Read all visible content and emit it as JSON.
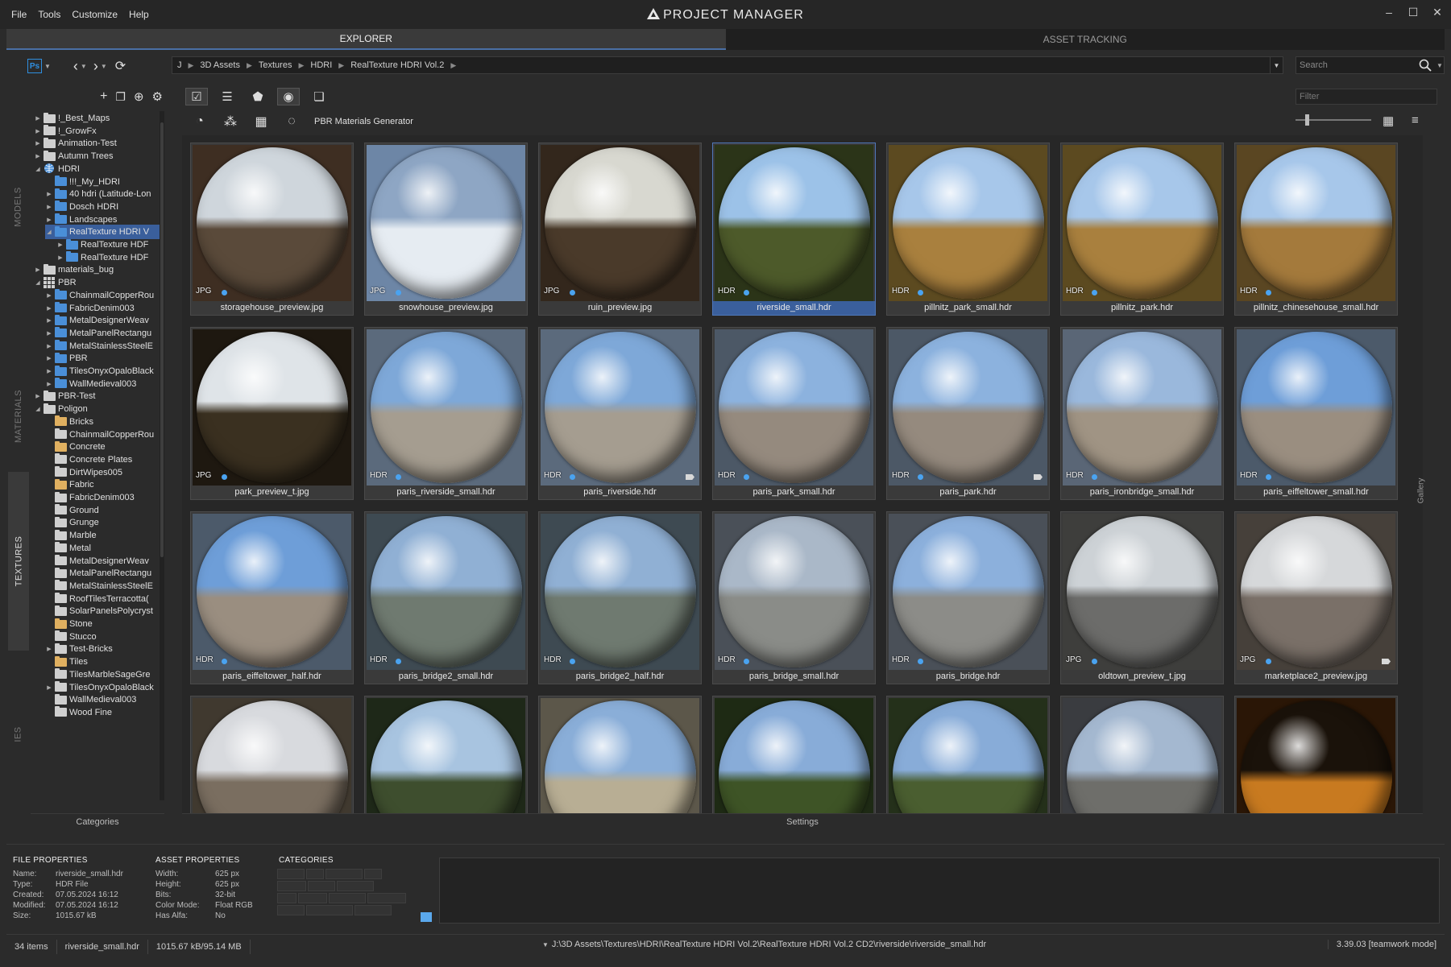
{
  "menu": [
    "File",
    "Tools",
    "Customize",
    "Help"
  ],
  "app_title": "PROJECT MANAGER",
  "window_controls": {
    "minimize": "–",
    "maximize": "☐",
    "close": "✕"
  },
  "main_tabs": [
    {
      "label": "EXPLORER",
      "active": true
    },
    {
      "label": "ASSET TRACKING",
      "active": false
    }
  ],
  "nav": {
    "app_icon": "Ps",
    "breadcrumb": [
      "J",
      "3D Assets",
      "Textures",
      "HDRI",
      "RealTexture HDRI Vol.2"
    ],
    "search_placeholder": "Search",
    "filter_placeholder": "Filter"
  },
  "side_tabs": [
    "MODELS",
    "MATERIALS",
    "TEXTURES",
    "IES"
  ],
  "side_tab_active": "TEXTURES",
  "tree": [
    {
      "label": "!_Best_Maps",
      "indent": 0,
      "arrow": "▶",
      "color": "#cfcfcf"
    },
    {
      "label": "!_GrowFx",
      "indent": 0,
      "arrow": "▶",
      "color": "#cfcfcf"
    },
    {
      "label": "Animation-Test",
      "indent": 0,
      "arrow": "▶",
      "color": "#cfcfcf"
    },
    {
      "label": "Autumn Trees",
      "indent": 0,
      "arrow": "▶",
      "color": "#cfcfcf"
    },
    {
      "label": "HDRI",
      "indent": 0,
      "arrow": "◢",
      "color": "#4a8fd8",
      "special": "globe"
    },
    {
      "label": "!!!_My_HDRI",
      "indent": 1,
      "arrow": "",
      "color": "#4a8fd8"
    },
    {
      "label": "40 hdri (Latitude-Lon",
      "indent": 1,
      "arrow": "▶",
      "color": "#4a8fd8"
    },
    {
      "label": "Dosch HDRI",
      "indent": 1,
      "arrow": "▶",
      "color": "#4a8fd8"
    },
    {
      "label": "Landscapes",
      "indent": 1,
      "arrow": "▶",
      "color": "#4a8fd8"
    },
    {
      "label": "RealTexture HDRI V",
      "indent": 1,
      "arrow": "◢",
      "color": "#4a8fd8",
      "selected": true
    },
    {
      "label": "RealTexture HDF",
      "indent": 2,
      "arrow": "▶",
      "color": "#4a8fd8"
    },
    {
      "label": "RealTexture HDF",
      "indent": 2,
      "arrow": "▶",
      "color": "#4a8fd8"
    },
    {
      "label": "materials_bug",
      "indent": 0,
      "arrow": "▶",
      "color": "#cfcfcf"
    },
    {
      "label": "PBR",
      "indent": 0,
      "arrow": "◢",
      "color": "#4a8fd8",
      "special": "grid"
    },
    {
      "label": "ChainmailCopperRou",
      "indent": 1,
      "arrow": "▶",
      "color": "#4a8fd8"
    },
    {
      "label": "FabricDenim003",
      "indent": 1,
      "arrow": "▶",
      "color": "#4a8fd8"
    },
    {
      "label": "MetalDesignerWeav",
      "indent": 1,
      "arrow": "▶",
      "color": "#4a8fd8"
    },
    {
      "label": "MetalPanelRectangu",
      "indent": 1,
      "arrow": "▶",
      "color": "#4a8fd8"
    },
    {
      "label": "MetalStainlessSteelE",
      "indent": 1,
      "arrow": "▶",
      "color": "#4a8fd8"
    },
    {
      "label": "PBR",
      "indent": 1,
      "arrow": "▶",
      "color": "#4a8fd8"
    },
    {
      "label": "TilesOnyxOpaloBlack",
      "indent": 1,
      "arrow": "▶",
      "color": "#4a8fd8"
    },
    {
      "label": "WallMedieval003",
      "indent": 1,
      "arrow": "▶",
      "color": "#4a8fd8"
    },
    {
      "label": "PBR-Test",
      "indent": 0,
      "arrow": "▶",
      "color": "#cfcfcf"
    },
    {
      "label": "Poligon",
      "indent": 0,
      "arrow": "◢",
      "color": "#cfcfcf"
    },
    {
      "label": "Bricks",
      "indent": 1,
      "arrow": "",
      "color": "#e0b060"
    },
    {
      "label": "ChainmailCopperRou",
      "indent": 1,
      "arrow": "",
      "color": "#cfcfcf"
    },
    {
      "label": "Concrete",
      "indent": 1,
      "arrow": "",
      "color": "#e0b060"
    },
    {
      "label": "Concrete Plates",
      "indent": 1,
      "arrow": "",
      "color": "#cfcfcf"
    },
    {
      "label": "DirtWipes005",
      "indent": 1,
      "arrow": "",
      "color": "#cfcfcf"
    },
    {
      "label": "Fabric",
      "indent": 1,
      "arrow": "",
      "color": "#e0b060"
    },
    {
      "label": "FabricDenim003",
      "indent": 1,
      "arrow": "",
      "color": "#cfcfcf"
    },
    {
      "label": "Ground",
      "indent": 1,
      "arrow": "",
      "color": "#cfcfcf"
    },
    {
      "label": "Grunge",
      "indent": 1,
      "arrow": "",
      "color": "#cfcfcf"
    },
    {
      "label": "Marble",
      "indent": 1,
      "arrow": "",
      "color": "#cfcfcf"
    },
    {
      "label": "Metal",
      "indent": 1,
      "arrow": "",
      "color": "#cfcfcf"
    },
    {
      "label": "MetalDesignerWeav",
      "indent": 1,
      "arrow": "",
      "color": "#cfcfcf"
    },
    {
      "label": "MetalPanelRectangu",
      "indent": 1,
      "arrow": "",
      "color": "#cfcfcf"
    },
    {
      "label": "MetalStainlessSteelE",
      "indent": 1,
      "arrow": "",
      "color": "#cfcfcf"
    },
    {
      "label": "RoofTilesTerracotta(",
      "indent": 1,
      "arrow": "",
      "color": "#cfcfcf"
    },
    {
      "label": "SolarPanelsPolycryst",
      "indent": 1,
      "arrow": "",
      "color": "#cfcfcf"
    },
    {
      "label": "Stone",
      "indent": 1,
      "arrow": "",
      "color": "#e0b060"
    },
    {
      "label": "Stucco",
      "indent": 1,
      "arrow": "",
      "color": "#cfcfcf"
    },
    {
      "label": "Test-Bricks",
      "indent": 1,
      "arrow": "▶",
      "color": "#cfcfcf"
    },
    {
      "label": "Tiles",
      "indent": 1,
      "arrow": "",
      "color": "#e0b060"
    },
    {
      "label": "TilesMarbleSageGre",
      "indent": 1,
      "arrow": "",
      "color": "#cfcfcf"
    },
    {
      "label": "TilesOnyxOpaloBlack",
      "indent": 1,
      "arrow": "▶",
      "color": "#cfcfcf"
    },
    {
      "label": "WallMedieval003",
      "indent": 1,
      "arrow": "",
      "color": "#cfcfcf"
    },
    {
      "label": "Wood Fine",
      "indent": 1,
      "arrow": "",
      "color": "#cfcfcf"
    }
  ],
  "tree_footer": "Categories",
  "generator_label": "PBR Materials Generator",
  "settings_label": "Settings",
  "gallery_label": "Gallery",
  "assets": [
    {
      "name": "storagehouse_preview.jpg",
      "format": "JPG",
      "sky": "#cfd6dc",
      "ground": "#5a4a3a",
      "rim": "#3e2e22"
    },
    {
      "name": "snowhouse_preview.jpg",
      "format": "JPG",
      "sky": "#8ea6c4",
      "ground": "#e6ecf2",
      "rim": "#6d86a6"
    },
    {
      "name": "ruin_preview.jpg",
      "format": "JPG",
      "sky": "#d8d8d0",
      "ground": "#4a3a2a",
      "rim": "#33271c"
    },
    {
      "name": "riverside_small.hdr",
      "format": "HDR",
      "sky": "#9cc2e8",
      "ground": "#4d5a2a",
      "rim": "#2b3418",
      "selected": true
    },
    {
      "name": "pillnitz_park_small.hdr",
      "format": "HDR",
      "sky": "#a7c7ea",
      "ground": "#a9803e",
      "rim": "#5c4a20"
    },
    {
      "name": "pillnitz_park.hdr",
      "format": "HDR",
      "sky": "#a7c7ea",
      "ground": "#a9803e",
      "rim": "#5c4a20"
    },
    {
      "name": "pillnitz_chinesehouse_small.hdr",
      "format": "HDR",
      "sky": "#a7c7ea",
      "ground": "#a47a3c",
      "rim": "#5a4622"
    },
    {
      "name": "park_preview_t.jpg",
      "format": "JPG",
      "sky": "#dfe4e8",
      "ground": "#3a3020",
      "rim": "#1e1810"
    },
    {
      "name": "paris_riverside_small.hdr",
      "format": "HDR",
      "sky": "#7ea8d8",
      "ground": "#a59d90",
      "rim": "#5b6a7c"
    },
    {
      "name": "paris_riverside.hdr",
      "format": "HDR",
      "sky": "#7ea8d8",
      "ground": "#a59d90",
      "rim": "#5b6a7c",
      "tagged": true
    },
    {
      "name": "paris_park_small.hdr",
      "format": "HDR",
      "sky": "#8cb2de",
      "ground": "#958a7e",
      "rim": "#4c5866"
    },
    {
      "name": "paris_park.hdr",
      "format": "HDR",
      "sky": "#8cb2de",
      "ground": "#958a7e",
      "rim": "#4c5866",
      "tagged": true
    },
    {
      "name": "paris_ironbridge_small.hdr",
      "format": "HDR",
      "sky": "#9ab8dc",
      "ground": "#a09484",
      "rim": "#5a6676"
    },
    {
      "name": "paris_eiffeltower_small.hdr",
      "format": "HDR",
      "sky": "#6e9ed8",
      "ground": "#9a8e80",
      "rim": "#4c5a6a"
    },
    {
      "name": "paris_eiffeltower_half.hdr",
      "format": "HDR",
      "sky": "#6e9ed8",
      "ground": "#9a8e80",
      "rim": "#4c5a6a"
    },
    {
      "name": "paris_bridge2_small.hdr",
      "format": "HDR",
      "sky": "#90b0d4",
      "ground": "#6f7a70",
      "rim": "#3e4a52"
    },
    {
      "name": "paris_bridge2_half.hdr",
      "format": "HDR",
      "sky": "#90b0d4",
      "ground": "#6f7a70",
      "rim": "#3e4a52"
    },
    {
      "name": "paris_bridge_small.hdr",
      "format": "HDR",
      "sky": "#aab8c8",
      "ground": "#8a8c88",
      "rim": "#4a5058"
    },
    {
      "name": "paris_bridge.hdr",
      "format": "HDR",
      "sky": "#8cb0dc",
      "ground": "#8c8c88",
      "rim": "#4a5058"
    },
    {
      "name": "oldtown_preview_t.jpg",
      "format": "JPG",
      "sky": "#cdd2d6",
      "ground": "#6c6c6a",
      "rim": "#3e3e3c"
    },
    {
      "name": "marketplace2_preview.jpg",
      "format": "JPG",
      "sky": "#d6d8da",
      "ground": "#7a7068",
      "rim": "#46403a",
      "tagged": true
    },
    {
      "name": "",
      "format": "",
      "sky": "#d8dade",
      "ground": "#7a6e60",
      "rim": "#40392f"
    },
    {
      "name": "",
      "format": "",
      "sky": "#a8c4e0",
      "ground": "#3e4e2e",
      "rim": "#1e2818"
    },
    {
      "name": "",
      "format": "",
      "sky": "#8aaed8",
      "ground": "#b8ae94",
      "rim": "#5c574a"
    },
    {
      "name": "",
      "format": "",
      "sky": "#88acd8",
      "ground": "#3e5426",
      "rim": "#1e2a14"
    },
    {
      "name": "",
      "format": "",
      "sky": "#88acd8",
      "ground": "#4a5e30",
      "rim": "#24301a"
    },
    {
      "name": "",
      "format": "",
      "sky": "#a4b8d0",
      "ground": "#6e6e6a",
      "rim": "#3a3c40"
    },
    {
      "name": "",
      "format": "",
      "sky": "#1a120a",
      "ground": "#c87a20",
      "rim": "#2a1606"
    }
  ],
  "file_properties": {
    "title": "FILE PROPERTIES",
    "rows": [
      {
        "k": "Name:",
        "v": "riverside_small.hdr"
      },
      {
        "k": "Type:",
        "v": "HDR File"
      },
      {
        "k": "Created:",
        "v": "07.05.2024 16:12"
      },
      {
        "k": "Modified:",
        "v": "07.05.2024 16:12"
      },
      {
        "k": "Size:",
        "v": "1015.67 kB"
      }
    ]
  },
  "asset_properties": {
    "title": "ASSET PROPERTIES",
    "rows": [
      {
        "k": "Width:",
        "v": "625 px"
      },
      {
        "k": "Height:",
        "v": "625 px"
      },
      {
        "k": "Bits:",
        "v": "32-bit"
      },
      {
        "k": "Color Mode:",
        "v": "Float RGB"
      },
      {
        "k": "Has Alfa:",
        "v": "No"
      }
    ]
  },
  "categories_title": "CATEGORIES",
  "status": {
    "items": "34 items",
    "selected": "riverside_small.hdr",
    "size": "1015.67 kB/95.14 MB",
    "path": "J:\\3D Assets\\Textures\\HDRI\\RealTexture HDRI Vol.2\\RealTexture HDRI Vol.2 CD2\\riverside\\riverside_small.hdr",
    "version": "3.39.03 [teamwork mode]"
  }
}
